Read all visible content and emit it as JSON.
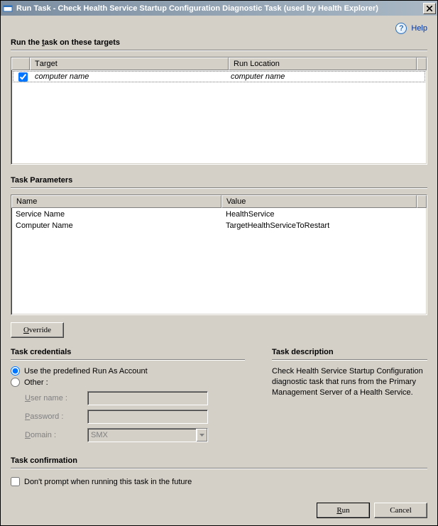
{
  "window": {
    "title": "Run Task - Check Health Service Startup Configuration Diagnostic Task (used by Health Explorer)"
  },
  "help": {
    "label": "Help"
  },
  "targets": {
    "title_prefix": "Run the ",
    "title_u": "t",
    "title_suffix": "ask on these targets",
    "col_target": "Target",
    "col_location": "Run Location",
    "rows": [
      {
        "checked": true,
        "target": "computer name",
        "location": "computer name"
      }
    ]
  },
  "params": {
    "title": "Task Parameters",
    "col_name": "Name",
    "col_value": "Value",
    "rows": [
      {
        "name": "Service Name",
        "value": "HealthService"
      },
      {
        "name": "Computer Name",
        "value": "TargetHealthServiceToRestart"
      }
    ]
  },
  "override": {
    "u": "O",
    "rest": "verride"
  },
  "credentials": {
    "title": "Task credentials",
    "predefined_label": "Use the predefined Run As Account",
    "other_label": "Other :",
    "selected": "predefined",
    "username": {
      "u": "U",
      "rest": "ser name :"
    },
    "password": {
      "u": "P",
      "rest": "assword :"
    },
    "domain": {
      "u": "D",
      "rest": "omain :",
      "value": "SMX"
    }
  },
  "description": {
    "title": "Task description",
    "text": "Check Health Service Startup Configuration diagnostic task that runs from the Primary Management Server of a Health Service."
  },
  "confirmation": {
    "title": "Task confirmation",
    "label": "Don't prompt when running this task in the future",
    "checked": false
  },
  "buttons": {
    "run_u": "R",
    "run_rest": "un",
    "cancel": "Cancel"
  }
}
